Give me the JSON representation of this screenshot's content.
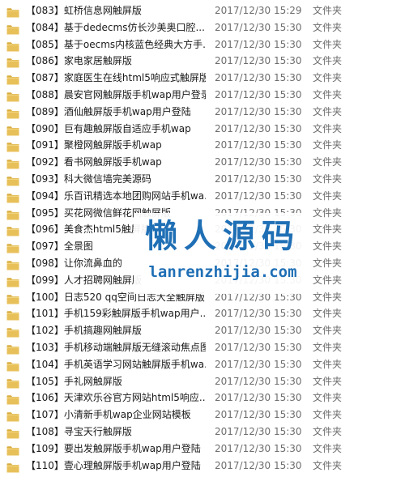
{
  "files": [
    {
      "name": "【083】虹桥信息网触屏版",
      "date": "2017/12/30 15:29",
      "type": "文件夹"
    },
    {
      "name": "【084】基于dedecms仿长沙美奥口腔...",
      "date": "2017/12/30 15:30",
      "type": "文件夹"
    },
    {
      "name": "【085】基于oecms内核蓝色经典大方手...",
      "date": "2017/12/30 15:30",
      "type": "文件夹"
    },
    {
      "name": "【086】家电家居触屏版",
      "date": "2017/12/30 15:30",
      "type": "文件夹"
    },
    {
      "name": "【087】家庭医生在线html5响应式触屏版",
      "date": "2017/12/30 15:30",
      "type": "文件夹"
    },
    {
      "name": "【088】晨安官网触屏版手机wap用户登录",
      "date": "2017/12/30 15:30",
      "type": "文件夹"
    },
    {
      "name": "【089】酒仙触屏版手机wap用户登陆",
      "date": "2017/12/30 15:30",
      "type": "文件夹"
    },
    {
      "name": "【090】巨有趣触屏版自适应手机wap",
      "date": "2017/12/30 15:30",
      "type": "文件夹"
    },
    {
      "name": "【091】聚橙网触屏版手机wap",
      "date": "2017/12/30 15:30",
      "type": "文件夹"
    },
    {
      "name": "【092】看书网触屏版手机wap",
      "date": "2017/12/30 15:30",
      "type": "文件夹"
    },
    {
      "name": "【093】科大微信墙完美源码",
      "date": "2017/12/30 15:30",
      "type": "文件夹"
    },
    {
      "name": "【094】乐百讯精选本地团购网站手机wa...",
      "date": "2017/12/30 15:30",
      "type": "文件夹"
    },
    {
      "name": "【095】买花网微信鲜花网触屏版",
      "date": "2017/12/30 15:30",
      "type": "文件夹"
    },
    {
      "name": "【096】美食杰html5触屏版",
      "date": "2017/12/30 15:30",
      "type": "文件夹"
    },
    {
      "name": "【097】全景图",
      "date": "2017/12/30 15:30",
      "type": "文件夹"
    },
    {
      "name": "【098】让你流鼻血的",
      "date": "2017/12/30 15:30",
      "type": "文件夹"
    },
    {
      "name": "【099】人才招聘网触屏版",
      "date": "2017/12/30 15:30",
      "type": "文件夹"
    },
    {
      "name": "【100】日志520 qq空间日志大全触屏版",
      "date": "2017/12/30 15:30",
      "type": "文件夹"
    },
    {
      "name": "【101】手机159彩触屏版手机wap用户...",
      "date": "2017/12/30 15:30",
      "type": "文件夹"
    },
    {
      "name": "【102】手机搞趣网触屏版",
      "date": "2017/12/30 15:30",
      "type": "文件夹"
    },
    {
      "name": "【103】手机移动端触屏版无缝滚动焦点图",
      "date": "2017/12/30 15:30",
      "type": "文件夹"
    },
    {
      "name": "【104】手机英语学习网站触屏版手机wa...",
      "date": "2017/12/30 15:30",
      "type": "文件夹"
    },
    {
      "name": "【105】手礼网触屏版",
      "date": "2017/12/30 15:30",
      "type": "文件夹"
    },
    {
      "name": "【106】天津欢乐谷官方网站html5响应...",
      "date": "2017/12/30 15:30",
      "type": "文件夹"
    },
    {
      "name": "【107】小清新手机wap企业网站模板",
      "date": "2017/12/30 15:30",
      "type": "文件夹"
    },
    {
      "name": "【108】寻宝天行触屏版",
      "date": "2017/12/30 15:30",
      "type": "文件夹"
    },
    {
      "name": "【109】要出发触屏版手机wap用户登陆",
      "date": "2017/12/30 15:30",
      "type": "文件夹"
    },
    {
      "name": "【110】壹心理触屏版手机wap用户登陆",
      "date": "2017/12/30 15:30",
      "type": "文件夹"
    }
  ],
  "icon": "folder-icon",
  "colors": {
    "folder_body": "#e8c05a",
    "folder_tab": "#d9ac3e",
    "name_text": "#1a1a1a",
    "meta_text": "#6d6d6d",
    "watermark": "#1f6fb5"
  },
  "watermark": {
    "title": "懒人源码",
    "url": "lanrenzhijia.com"
  }
}
